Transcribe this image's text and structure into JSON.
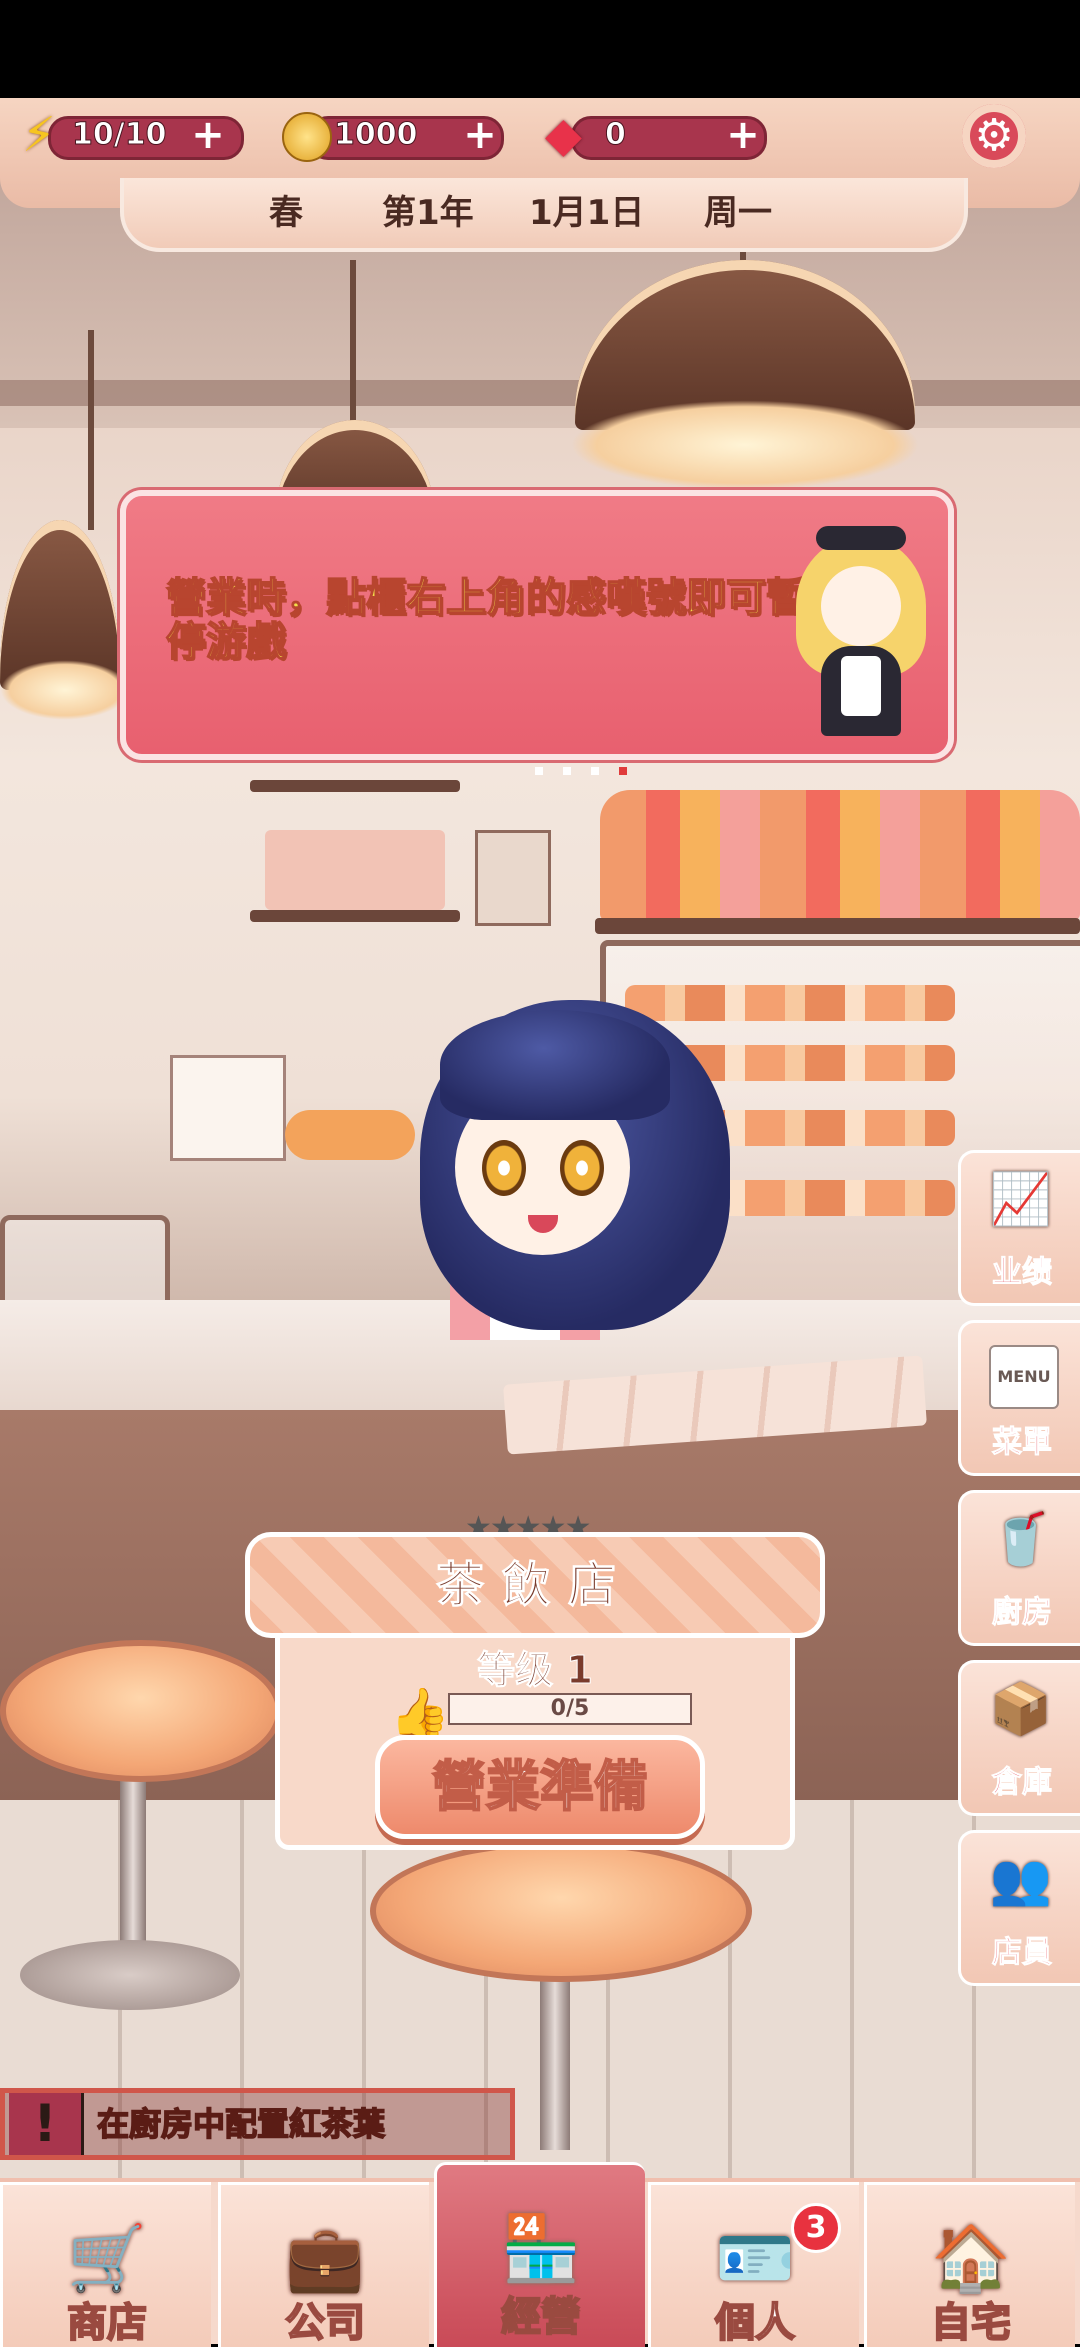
{
  "resources": {
    "energy": {
      "icon": "lightning-icon",
      "value": "10/10"
    },
    "coins": {
      "icon": "coin-icon",
      "value": "1000"
    },
    "gems": {
      "icon": "gem-icon",
      "value": "0"
    }
  },
  "date": {
    "season": "春",
    "year": "第1年",
    "day": "1月1日",
    "weekday": "周一"
  },
  "tip": {
    "text": "營業時，點櫃右上角的感嘆號即可暫停游戲",
    "page_count": 4,
    "active_page": 4
  },
  "side_menu": [
    {
      "label": "业绩",
      "icon": "chart-icon"
    },
    {
      "label": "菜單",
      "icon": "menu-icon",
      "icon_text": "MENU"
    },
    {
      "label": "廚房",
      "icon": "blender-icon"
    },
    {
      "label": "倉庫",
      "icon": "box-icon"
    },
    {
      "label": "店員",
      "icon": "staff-icon"
    }
  ],
  "shop": {
    "stars": "★★★★★",
    "rating": 0,
    "name": "茶飲店",
    "level": "等级 1",
    "progress_text": "0/5",
    "progress_fraction": 0,
    "start_button": "營業準備"
  },
  "quest": {
    "text": "在廚房中配置紅茶葉"
  },
  "nav": [
    {
      "label": "商店",
      "icon": "cart-icon"
    },
    {
      "label": "公司",
      "icon": "briefcase-icon"
    },
    {
      "label": "經營",
      "icon": "store-icon",
      "active": true
    },
    {
      "label": "個人",
      "icon": "card-icon",
      "badge": "3"
    },
    {
      "label": "自宅",
      "icon": "house-icon"
    }
  ],
  "colors": {
    "accent": "#a8354d",
    "tip_bg": "#e8606f",
    "tip_text": "#f2df4a",
    "panel": "#f8d9c9"
  }
}
